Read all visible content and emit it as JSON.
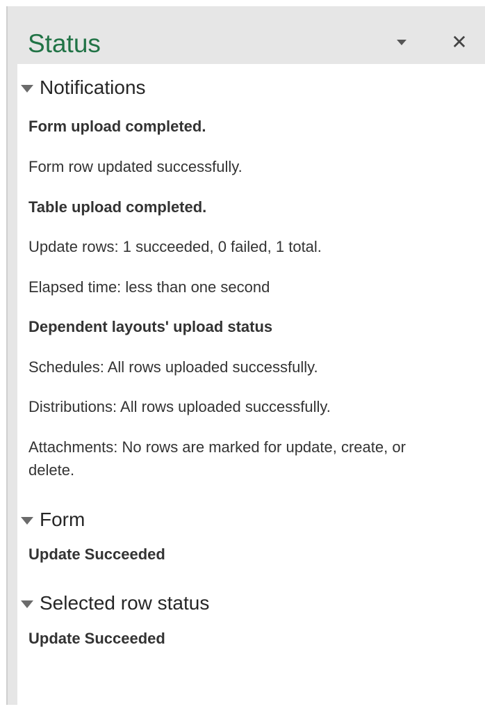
{
  "pane": {
    "title": "Status",
    "options_icon": "dropdown-triangle-icon",
    "close_icon": "close-icon",
    "close_glyph": "✕",
    "accent_color": "#217346"
  },
  "sections": {
    "notifications": {
      "title": "Notifications",
      "messages": [
        "Form upload completed.",
        "Form row updated successfully.",
        "Table upload completed.",
        "Update rows:  1 succeeded, 0 failed, 1 total.",
        "Elapsed time: less than one second",
        "Dependent layouts' upload status",
        "Schedules: All rows uploaded successfully.",
        "Distributions: All rows uploaded successfully.",
        "Attachments: No rows are marked for update, create, or delete."
      ]
    },
    "form": {
      "title": "Form",
      "messages": [
        "Update Succeeded"
      ]
    },
    "selected_row_status": {
      "title": "Selected row status",
      "messages": [
        "Update Succeeded"
      ]
    }
  }
}
